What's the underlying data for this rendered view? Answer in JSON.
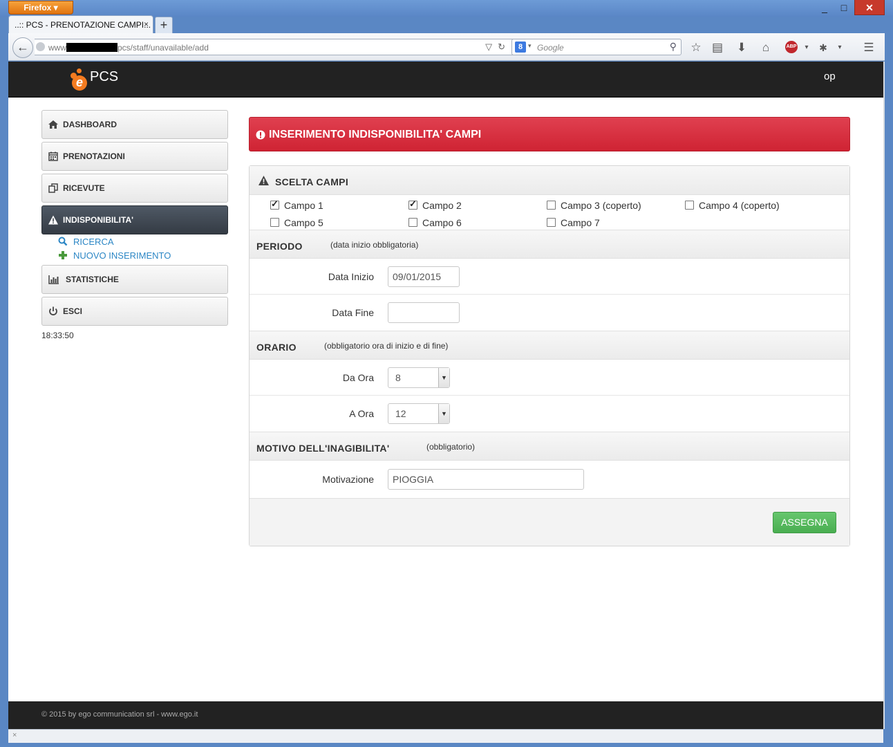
{
  "browser": {
    "menu_button": "Firefox",
    "minimize": "_",
    "maximize": "□",
    "close": "✕",
    "tab_title": "..:: PCS - PRENOTAZIONE CAMPI...",
    "tab_close": "×",
    "new_tab": "+",
    "url_prefix": "www",
    "url_path": "pcs/staff/unavailable/add",
    "search_placeholder": "Google",
    "search_engine_letter": "8",
    "status_close": "×",
    "icons": [
      "back-arrow-icon",
      "globe-icon",
      "reload-icon",
      "search-icon",
      "star-icon",
      "reading-list-icon",
      "download-icon",
      "home-icon",
      "adblock-icon",
      "extension-icon",
      "menu-icon"
    ]
  },
  "app": {
    "brand": "PCS",
    "user": "op"
  },
  "sidebar": {
    "items": [
      {
        "label": "DASHBOARD",
        "icon": "home-icon"
      },
      {
        "label": "PRENOTAZIONI",
        "icon": "calendar-icon"
      },
      {
        "label": "RICEVUTE",
        "icon": "copy-icon"
      },
      {
        "label": "INDISPONIBILITA'",
        "icon": "warning-icon",
        "active": true
      },
      {
        "label": "STATISTICHE",
        "icon": "bar-chart-icon"
      },
      {
        "label": "ESCI",
        "icon": "power-icon"
      }
    ],
    "sub_links": [
      {
        "label": "RICERCA",
        "icon": "search-icon"
      },
      {
        "label": "NUOVO INSERIMENTO",
        "icon": "plus-icon"
      }
    ],
    "clock": "18:33:50"
  },
  "alert": {
    "title": "INSERIMENTO INDISPONIBILITA' CAMPI",
    "color": "#d32638"
  },
  "form": {
    "fields_section": {
      "title": "SCELTA CAMPI",
      "fields": [
        {
          "label": "Campo 1",
          "checked": true
        },
        {
          "label": "Campo 2",
          "checked": true
        },
        {
          "label": "Campo 3 (coperto)",
          "checked": false
        },
        {
          "label": "Campo 4 (coperto)",
          "checked": false
        },
        {
          "label": "Campo 5",
          "checked": false
        },
        {
          "label": "Campo 6",
          "checked": false
        },
        {
          "label": "Campo 7",
          "checked": false
        }
      ]
    },
    "period": {
      "title": "PERIODO",
      "note": "(data inizio obbligatoria)",
      "start_label": "Data Inizio",
      "start_value": "09/01/2015",
      "end_label": "Data Fine",
      "end_value": ""
    },
    "hours": {
      "title": "ORARIO",
      "note": "(obbligatorio ora di inizio e di fine)",
      "from_label": "Da Ora",
      "from_value": "8",
      "to_label": "A Ora",
      "to_value": "12"
    },
    "reason": {
      "title": "MOTIVO DELL'INAGIBILITA'",
      "note": "(obbligatorio)",
      "label": "Motivazione",
      "value": "PIOGGIA"
    },
    "submit": "ASSEGNA",
    "submit_color": "#5cb85c"
  },
  "footer": {
    "text": "© 2015 by ego communication srl - www.ego.it"
  }
}
